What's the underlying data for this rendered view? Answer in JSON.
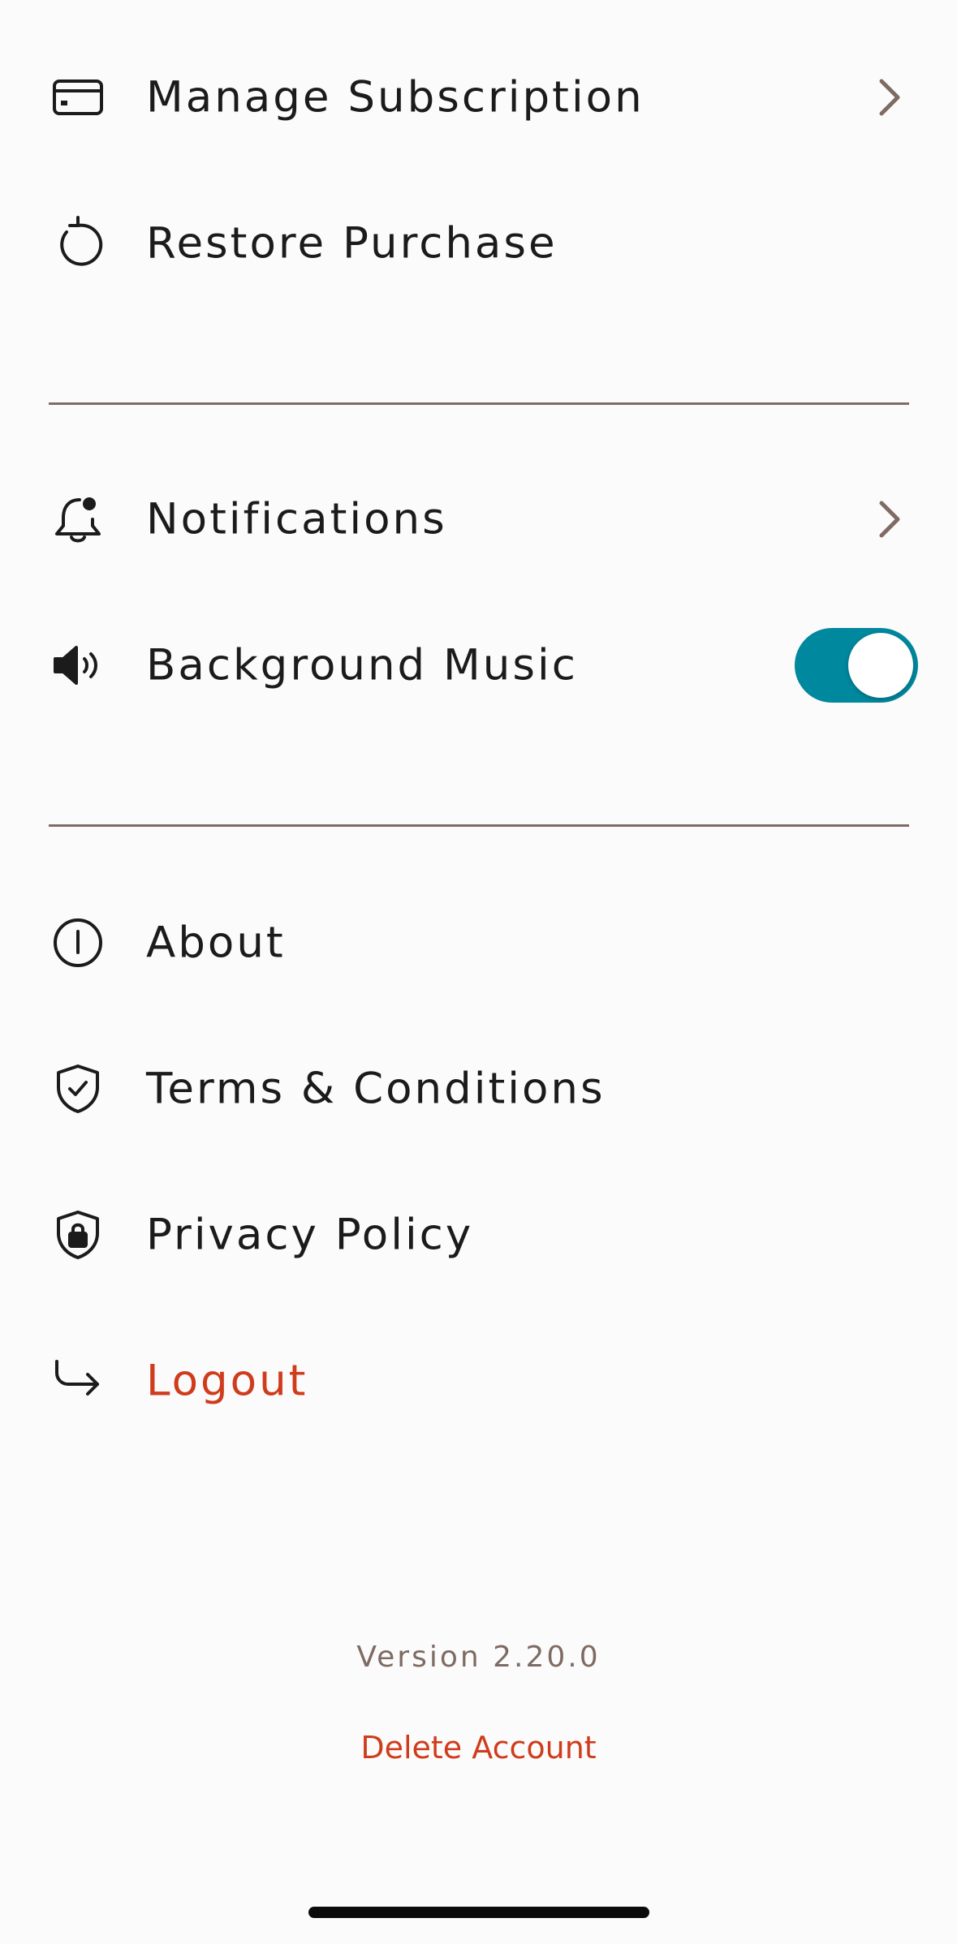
{
  "menu": {
    "manage_subscription": {
      "label": "Manage Subscription",
      "icon": "credit-card-icon"
    },
    "restore_purchase": {
      "label": "Restore Purchase",
      "icon": "restore-icon"
    },
    "notifications": {
      "label": "Notifications",
      "icon": "bell-badge-icon"
    },
    "background_music": {
      "label": "Background Music",
      "icon": "speaker-icon",
      "enabled": true
    },
    "about": {
      "label": "About",
      "icon": "info-circle-icon"
    },
    "terms": {
      "label": "Terms & Conditions",
      "icon": "shield-check-icon"
    },
    "privacy": {
      "label": "Privacy Policy",
      "icon": "shield-lock-icon"
    },
    "logout": {
      "label": "Logout",
      "icon": "logout-arrow-icon"
    }
  },
  "footer": {
    "version": "Version 2.20.0",
    "delete_account": "Delete Account"
  },
  "colors": {
    "accent_toggle": "#00889e",
    "danger": "#cf3c1c",
    "divider": "#7e6b63",
    "chevron": "#7e6b63",
    "background": "#fcfbfb",
    "text": "#1c1b1b"
  }
}
